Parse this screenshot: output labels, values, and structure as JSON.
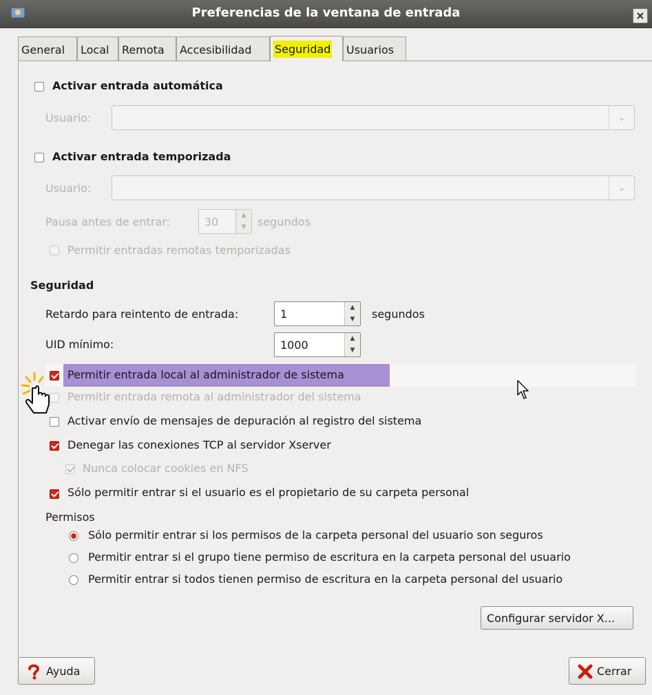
{
  "window": {
    "title": "Preferencias de la ventana de entrada",
    "close_glyph": "×"
  },
  "tabs": [
    {
      "label": "General"
    },
    {
      "label": "Local"
    },
    {
      "label": "Remota"
    },
    {
      "label": "Accesibilidad"
    },
    {
      "label": "Seguridad",
      "active": true
    },
    {
      "label": "Usuarios"
    }
  ],
  "auto_login": {
    "checkbox_label": "Activar entrada automática",
    "checked": false,
    "user_label": "Usuario:",
    "user_value": ""
  },
  "timed_login": {
    "checkbox_label": "Activar entrada temporizada",
    "checked": false,
    "user_label": "Usuario:",
    "user_value": "",
    "pause_label": "Pausa antes de entrar:",
    "pause_value": "30",
    "pause_unit": "segundos",
    "remote_checkbox_label": "Permitir entradas remotas temporizadas"
  },
  "security": {
    "heading": "Seguridad",
    "retry_label": "Retardo para reintento de entrada:",
    "retry_value": "1",
    "retry_unit": "segundos",
    "uid_label": "UID mínimo:",
    "uid_value": "1000",
    "options": {
      "local_admin": "Permitir entrada local al administrador de sistema",
      "remote_admin": "Permitir entrada remota al administrador del sistema",
      "debug": "Activar envío de mensajes de depuración al registro del sistema",
      "deny_tcp": "Denegar las conexiones TCP al servidor Xserver",
      "nfs_cookies": "Nunca colocar cookies en NFS",
      "owner_only": "Sólo permitir entrar si el usuario es el propietario de su carpeta personal"
    },
    "permissions_heading": "Permisos",
    "permissions": [
      "Sólo permitir entrar si los permisos de la carpeta personal del usuario son seguros",
      "Permitir entrar si el grupo tiene permiso de escritura en la carpeta personal del usuario",
      "Permitir entrar si todos tienen permiso de escritura en la carpeta personal del usuario"
    ],
    "selected_permission": 0
  },
  "buttons": {
    "configure_x": "Configurar servidor X...",
    "help": "Ayuda",
    "close": "Cerrar"
  },
  "colors": {
    "tab_highlight": "#f0f000",
    "row_highlight": "#a98fd3",
    "check_red": "#d0261c"
  }
}
